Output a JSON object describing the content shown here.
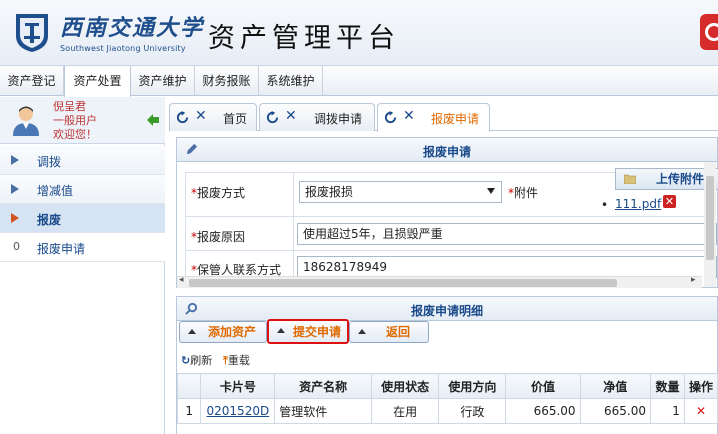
{
  "header": {
    "logo_cn": "西南交通大学",
    "logo_en": "Southwest Jiaotong University",
    "title": "资产管理平台",
    "accent": "#1f4e8c"
  },
  "menu": [
    "资产登记",
    "资产处置",
    "资产维护",
    "财务报账",
    "系统维护"
  ],
  "menu_active": "资产处置",
  "user": {
    "name": "倪呈君",
    "role": "一般用户",
    "greeting": "欢迎您！"
  },
  "sidebar": {
    "items": [
      {
        "label": "调拨",
        "icon": "arrow-right-icon"
      },
      {
        "label": "增减值",
        "icon": "arrow-right-icon"
      },
      {
        "label": "报废",
        "icon": "arrow-right-icon",
        "active": true
      },
      {
        "label": "报废申请",
        "num": "0"
      }
    ]
  },
  "tabs": [
    {
      "label": "首页"
    },
    {
      "label": "调拨申请"
    },
    {
      "label": "报废申请",
      "active": true
    }
  ],
  "form": {
    "title": "报废申请",
    "method_label": "报废方式",
    "method_value": "报废报损",
    "attach_label": "附件",
    "upload_label": "上传附件",
    "file_name": "111.pdf",
    "reason_label": "报废原因",
    "reason_value": "使用超过5年，且损毁严重",
    "contact_label": "保管人联系方式",
    "contact_value": "18628178949"
  },
  "detail": {
    "title": "报废申请明细",
    "add_label": "添加资产",
    "submit_label": "提交申请",
    "back_label": "返回",
    "refresh_label": "刷新",
    "reload_label": "重载"
  },
  "table": {
    "headers": [
      "",
      "卡片号",
      "资产名称",
      "使用状态",
      "使用方向",
      "价值",
      "净值",
      "数量",
      "操作"
    ],
    "rows": [
      {
        "idx": "1",
        "card": "0201520D",
        "name": "管理软件",
        "status": "在用",
        "direction": "行政",
        "value": "665.00",
        "net": "665.00",
        "qty": "1"
      }
    ]
  }
}
